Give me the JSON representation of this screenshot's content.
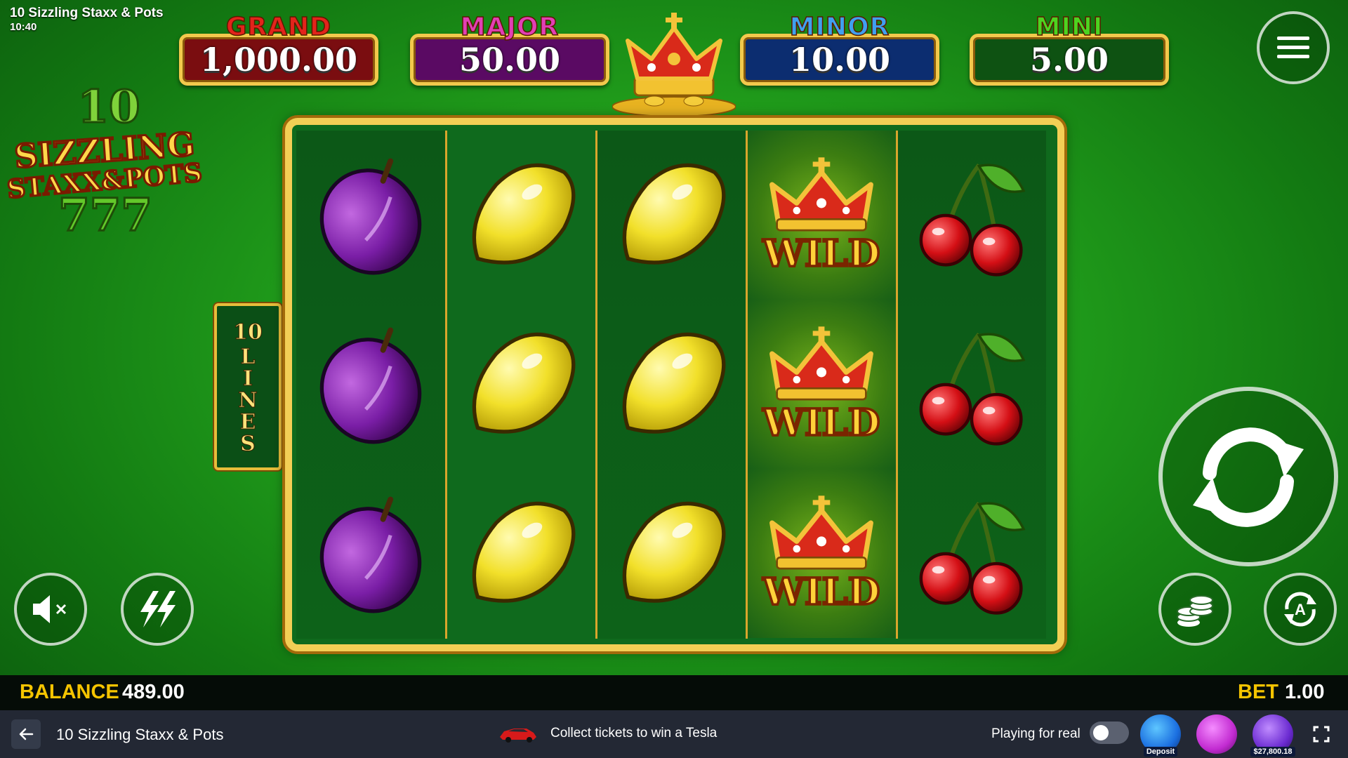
{
  "header": {
    "title": "10 Sizzling Staxx & Pots",
    "clock": "10:40"
  },
  "jackpots": [
    {
      "label": "GRAND",
      "value": "1,000.00",
      "label_color": "#e3241b",
      "box_color": "#7a0d10"
    },
    {
      "label": "MAJOR",
      "value": "50.00",
      "label_color": "#e23fb4",
      "box_color": "#5a0a63"
    },
    {
      "label": "MINOR",
      "value": "10.00",
      "label_color": "#3fa0f0",
      "box_color": "#0c2d70"
    },
    {
      "label": "MINI",
      "value": "5.00",
      "label_color": "#4cd420",
      "box_color": "#0e5212"
    }
  ],
  "logo": {
    "number": "10",
    "line1": "SIZZLING",
    "line2": "STAXX&POTS",
    "sevens": "777"
  },
  "lines_banner": {
    "number": "10",
    "word": "LINES"
  },
  "reels": [
    [
      "plum",
      "plum",
      "plum"
    ],
    [
      "lemon",
      "lemon",
      "lemon"
    ],
    [
      "lemon",
      "lemon",
      "lemon"
    ],
    [
      "wild",
      "wild",
      "wild"
    ],
    [
      "cherry",
      "cherry",
      "cherry"
    ]
  ],
  "wild_label": "WILD",
  "controls": {
    "menu_icon": "hamburger-icon",
    "spin_icon": "spin-arrows-icon",
    "sound_icon": "sound-muted-icon",
    "turbo_icon": "lightning-icon",
    "bet_icon": "coins-icon",
    "auto_icon": "autoplay-icon"
  },
  "status": {
    "balance_label": "BALANCE",
    "balance_value": "489.00",
    "bet_label": "BET",
    "bet_value": "1.00"
  },
  "bottom_bar": {
    "title": "10 Sizzling Staxx & Pots",
    "promo_text": "Collect tickets to win a Tesla",
    "real_label": "Playing for real",
    "badges": [
      {
        "name": "BONUZ",
        "caption": "Deposit",
        "color": "#1b6fe0"
      },
      {
        "name": "PIGGYZ",
        "caption": "",
        "color": "#c22bd1"
      },
      {
        "name": "JACKPOTZ",
        "caption": "$27,800.18",
        "color": "#6b2bd1"
      }
    ]
  }
}
